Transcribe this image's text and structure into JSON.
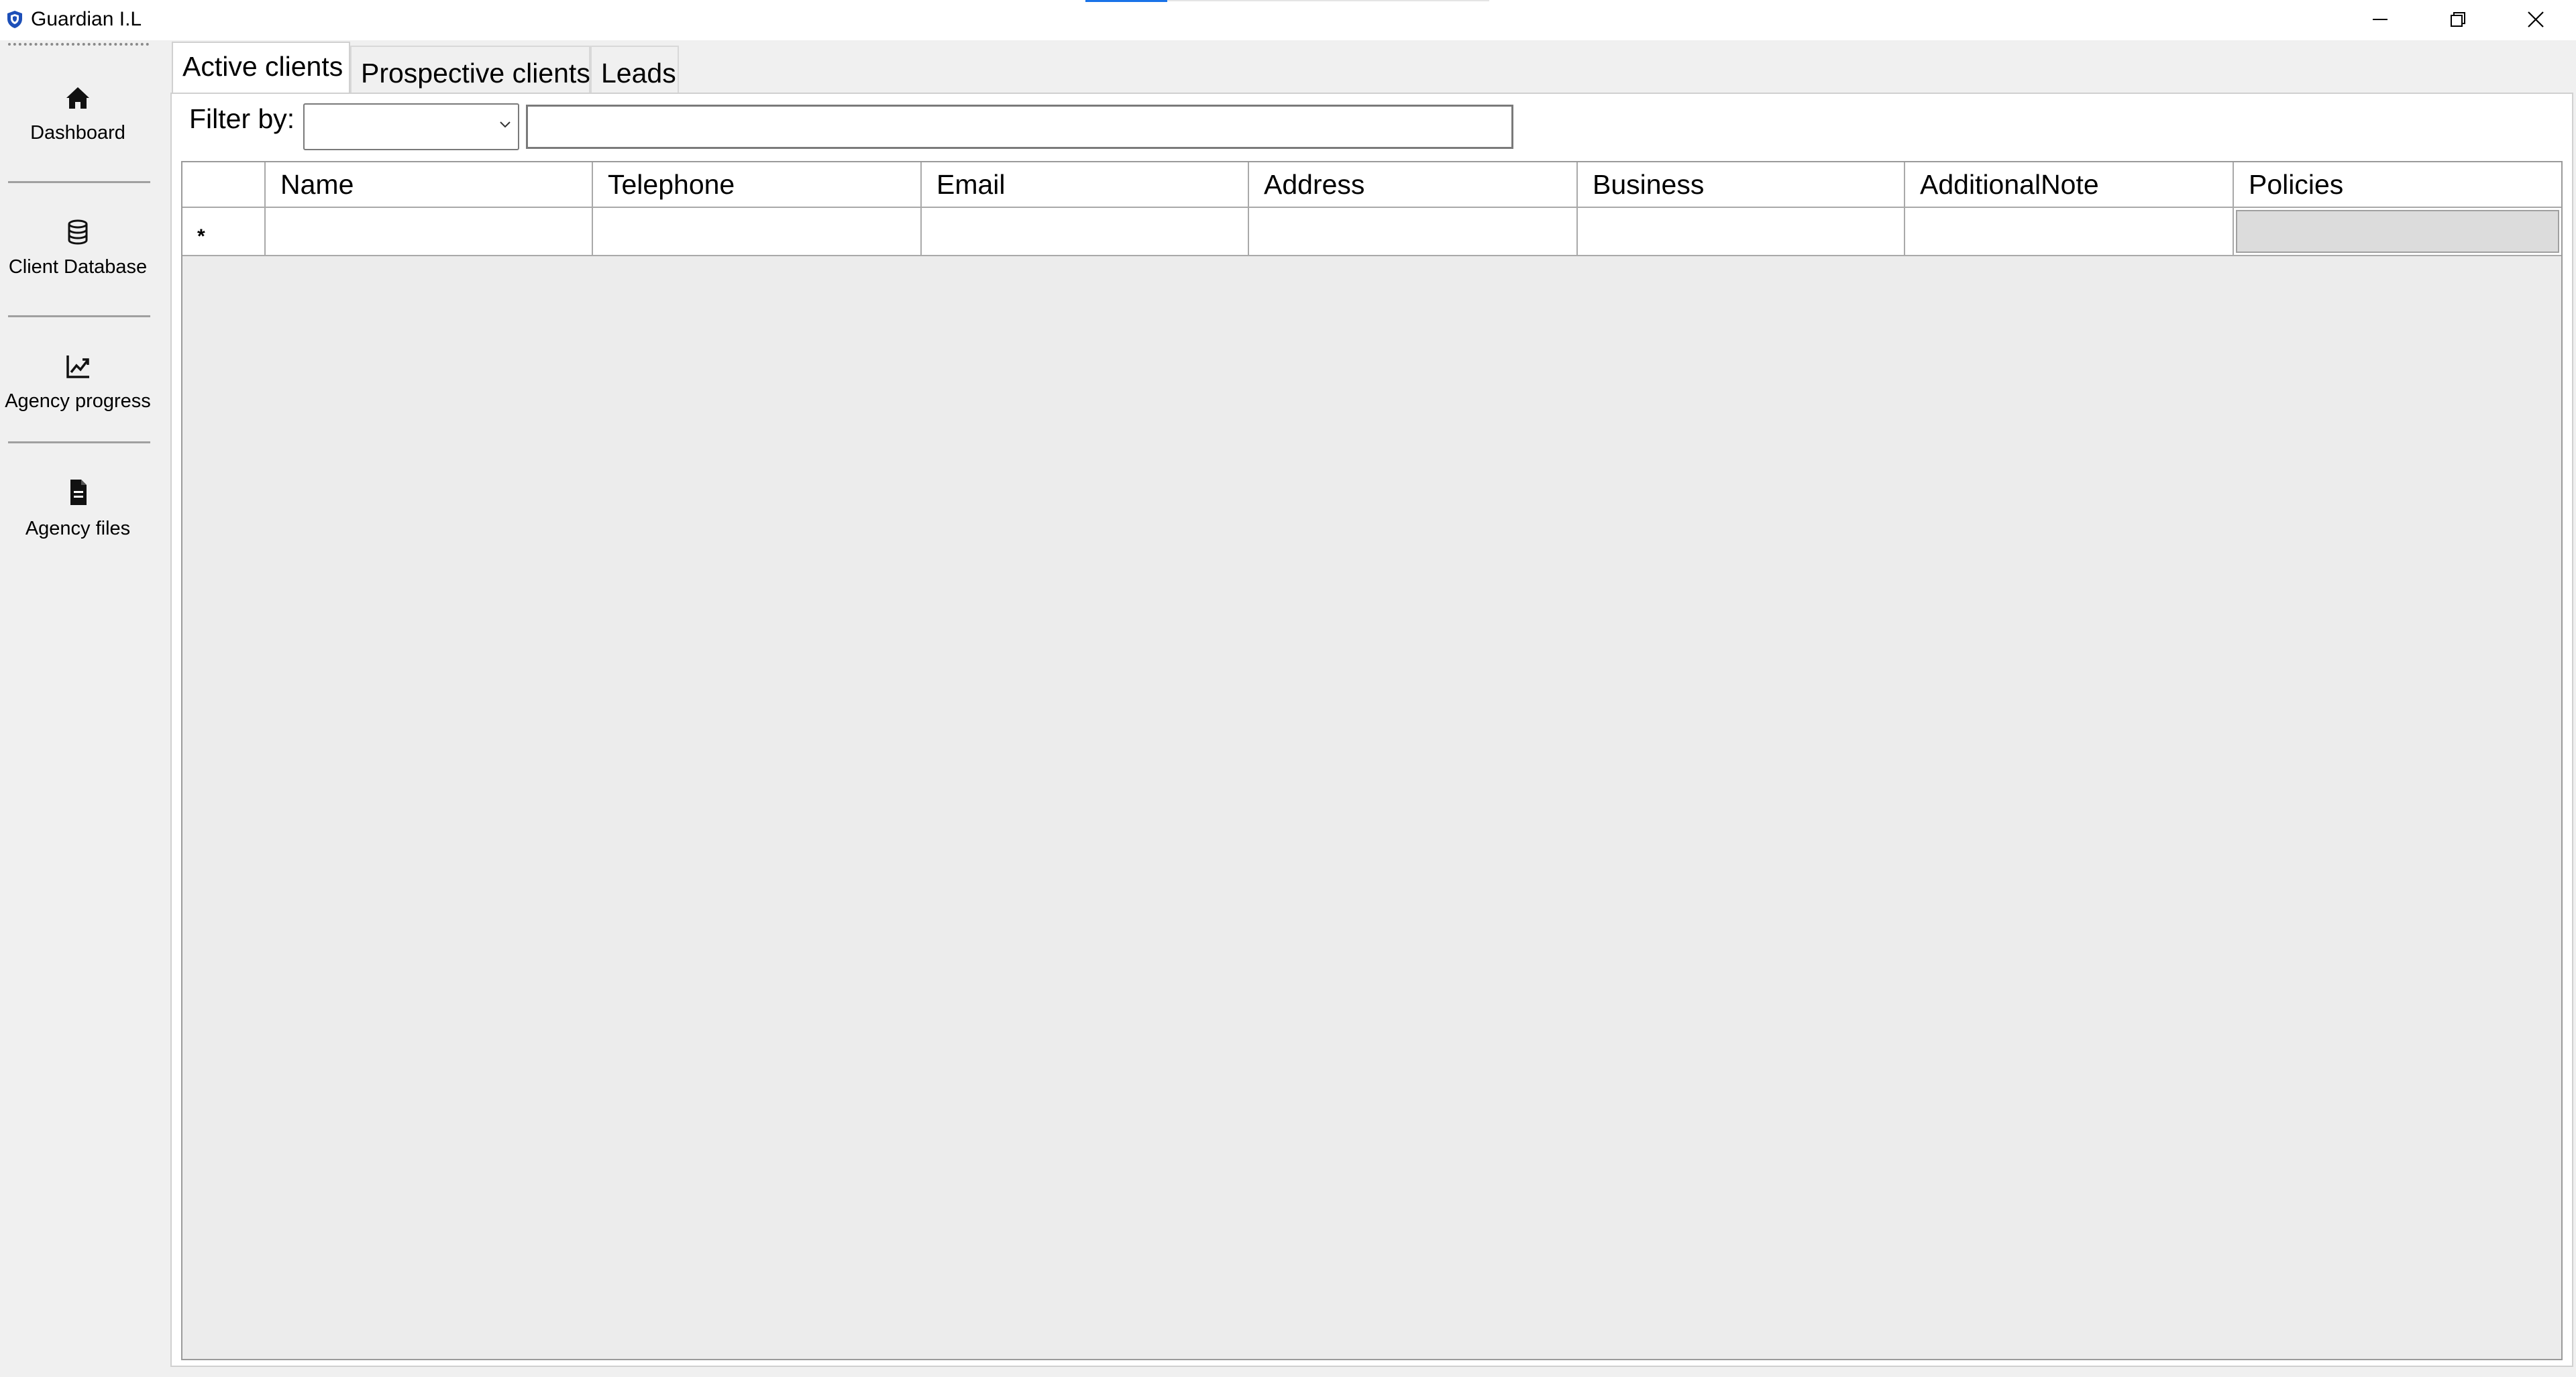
{
  "window": {
    "title": "Guardian I.L",
    "controls": [
      "minimize",
      "restore",
      "close"
    ]
  },
  "sidebar": {
    "items": [
      {
        "label": "Dashboard",
        "icon": "home-icon"
      },
      {
        "label": "Client Database",
        "icon": "database-icon"
      },
      {
        "label": "Agency progress",
        "icon": "line-chart-icon"
      },
      {
        "label": "Agency files",
        "icon": "file-icon"
      }
    ]
  },
  "tabs": [
    {
      "label": "Active clients",
      "active": true
    },
    {
      "label": "Prospective clients",
      "active": false
    },
    {
      "label": "Leads",
      "active": false
    }
  ],
  "filter": {
    "label": "Filter by:",
    "selected": "",
    "value": ""
  },
  "grid": {
    "columns": [
      "Name",
      "Telephone",
      "Email",
      "Address",
      "Business",
      "AdditionalNote",
      "Policies"
    ],
    "new_row_marker": "*",
    "rows": []
  },
  "colors": {
    "accent": "#1a73e8",
    "sidebar_bg": "#f0f0f0",
    "grid_bg": "#ececec",
    "button_cell_bg": "#dcdcdc"
  }
}
